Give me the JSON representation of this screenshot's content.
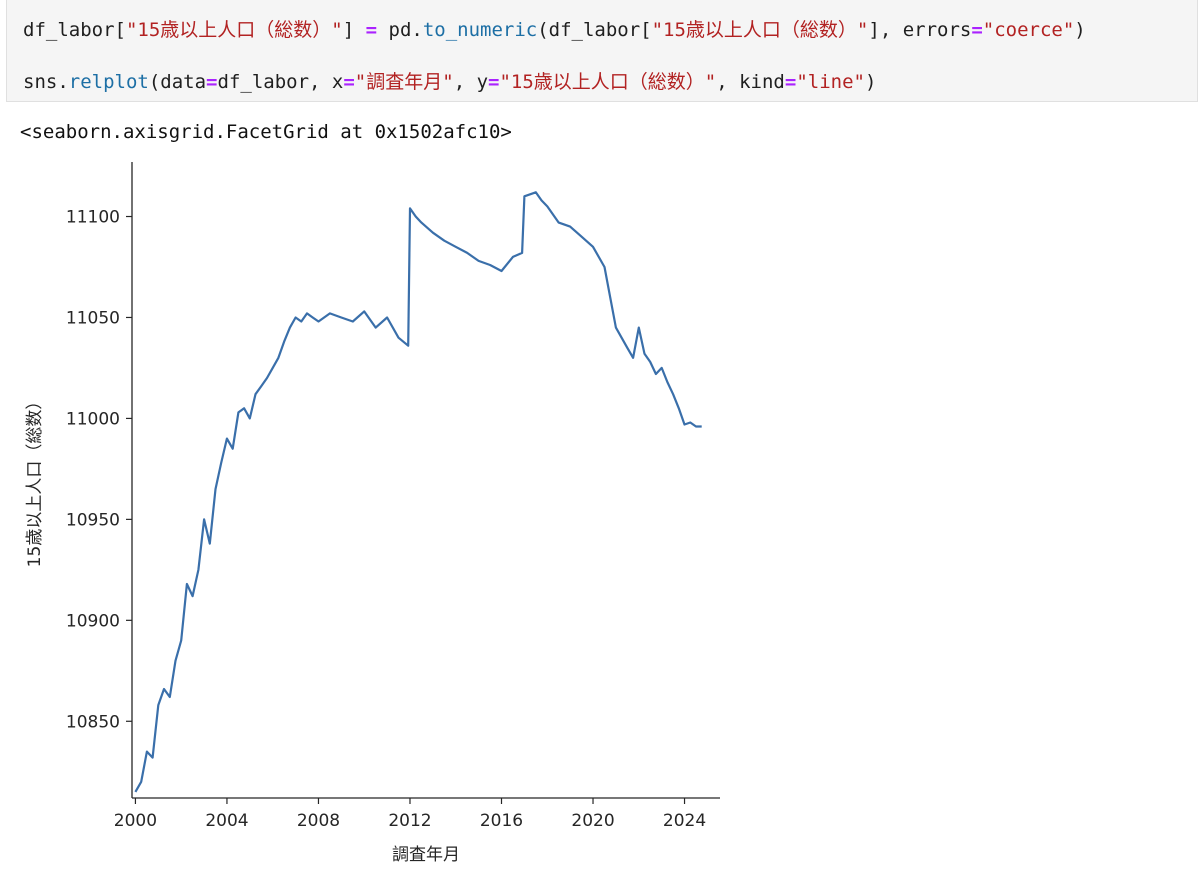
{
  "cell": {
    "line1": {
      "a": "df_labor[",
      "b": "\"15歳以上人口（総数）\"",
      "c": "] ",
      "d": "=",
      "e": " pd.",
      "f": "to_numeric",
      "g": "(df_labor[",
      "h": "\"15歳以上人口（総数）\"",
      "i": "], errors",
      "j": "=",
      "k": "\"coerce\"",
      "l": ")"
    },
    "line2": {
      "a": "sns.",
      "b": "relplot",
      "c": "(data",
      "d": "=",
      "e": "df_labor, x",
      "f": "=",
      "g": "\"調査年月\"",
      "h": ", y",
      "i": "=",
      "j": "\"15歳以上人口（総数）\"",
      "k": ", kind",
      "l": "=",
      "m": "\"line\"",
      "n": ")"
    }
  },
  "output": {
    "repr": "<seaborn.axisgrid.FacetGrid at 0x1502afc10>"
  },
  "colors": {
    "line": "#3a6faa",
    "axis": "#262626",
    "tick_text": "#262626"
  },
  "chart_data": {
    "type": "line",
    "xlabel": "調査年月",
    "ylabel": "15歳以上人口（総数）",
    "xlim": [
      1999.85,
      2025.55
    ],
    "ylim": [
      10812,
      11127
    ],
    "xticks": [
      2000,
      2004,
      2008,
      2012,
      2016,
      2020,
      2024
    ],
    "yticks": [
      10850,
      10900,
      10950,
      11000,
      11050,
      11100
    ],
    "grid": false,
    "x": [
      2000.0,
      2000.25,
      2000.5,
      2000.75,
      2001.0,
      2001.25,
      2001.5,
      2001.75,
      2002.0,
      2002.25,
      2002.5,
      2002.75,
      2003.0,
      2003.25,
      2003.5,
      2003.75,
      2004.0,
      2004.25,
      2004.5,
      2004.75,
      2005.0,
      2005.25,
      2005.5,
      2005.75,
      2006.0,
      2006.25,
      2006.5,
      2006.75,
      2007.0,
      2007.25,
      2007.5,
      2007.75,
      2008.0,
      2008.5,
      2009.0,
      2009.5,
      2010.0,
      2010.5,
      2011.0,
      2011.5,
      2011.92,
      2012.0,
      2012.25,
      2012.5,
      2013.0,
      2013.5,
      2014.0,
      2014.5,
      2015.0,
      2015.5,
      2016.0,
      2016.5,
      2016.9,
      2017.0,
      2017.5,
      2017.75,
      2018.0,
      2018.5,
      2019.0,
      2019.5,
      2020.0,
      2020.5,
      2020.75,
      2021.0,
      2021.25,
      2021.5,
      2021.75,
      2022.0,
      2022.25,
      2022.5,
      2022.75,
      2023.0,
      2023.25,
      2023.5,
      2023.75,
      2024.0,
      2024.25,
      2024.5,
      2024.75
    ],
    "y": [
      10815,
      10820,
      10835,
      10832,
      10858,
      10866,
      10862,
      10880,
      10890,
      10918,
      10912,
      10925,
      10950,
      10938,
      10965,
      10978,
      10990,
      10985,
      11003,
      11005,
      11000,
      11012,
      11016,
      11020,
      11025,
      11030,
      11038,
      11045,
      11050,
      11048,
      11052,
      11050,
      11048,
      11052,
      11050,
      11048,
      11053,
      11045,
      11050,
      11040,
      11036,
      11104,
      11100,
      11097,
      11092,
      11088,
      11085,
      11082,
      11078,
      11076,
      11073,
      11080,
      11082,
      11110,
      11112,
      11108,
      11105,
      11097,
      11095,
      11090,
      11085,
      11075,
      11060,
      11045,
      11040,
      11035,
      11030,
      11045,
      11032,
      11028,
      11022,
      11025,
      11018,
      11012,
      11005,
      10997,
      10998,
      10996,
      10996
    ]
  }
}
